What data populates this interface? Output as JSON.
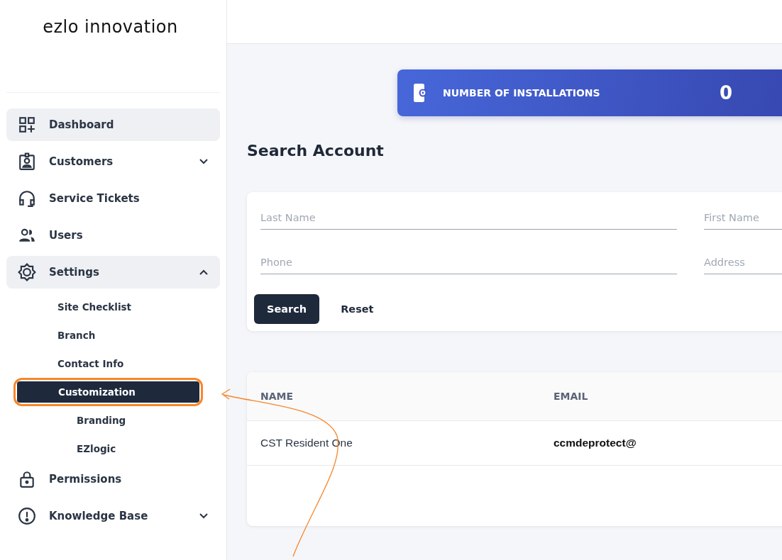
{
  "logo": "ezlo innovation",
  "sidebar": {
    "items": [
      {
        "label": "Dashboard",
        "selected": true
      },
      {
        "label": "Customers",
        "expanded": false,
        "selected": false
      },
      {
        "label": "Service Tickets",
        "selected": false
      },
      {
        "label": "Users",
        "selected": false
      },
      {
        "label": "Settings",
        "expanded": true,
        "selected": true,
        "children": [
          {
            "label": "Site Checklist",
            "selected": false,
            "highlighted": false
          },
          {
            "label": "Branch",
            "selected": false,
            "highlighted": false
          },
          {
            "label": "Contact Info",
            "selected": false,
            "highlighted": false
          },
          {
            "label": "Customization",
            "selected": true,
            "highlighted": true,
            "children": [
              {
                "label": "Branding",
                "selected": false
              },
              {
                "label": "EZlogic",
                "selected": false
              }
            ]
          }
        ]
      },
      {
        "label": "Permissions",
        "selected": false
      },
      {
        "label": "Knowledge Base",
        "expanded": false,
        "selected": false
      }
    ]
  },
  "stat_card": {
    "label": "NUMBER OF INSTALLATIONS",
    "value": "0"
  },
  "search": {
    "title": "Search Account",
    "fields": [
      {
        "placeholder": "Last Name"
      },
      {
        "placeholder": "First Name"
      },
      {
        "placeholder": "Phone"
      },
      {
        "placeholder": "Address"
      }
    ],
    "buttons": [
      {
        "label": "Search",
        "kind": "primary"
      },
      {
        "label": "Reset",
        "kind": "text"
      }
    ]
  },
  "table": {
    "columns": [
      "NAME",
      "EMAIL"
    ],
    "rows": [
      [
        "CST Resident One",
        "ccmdeprotect@"
      ]
    ]
  }
}
